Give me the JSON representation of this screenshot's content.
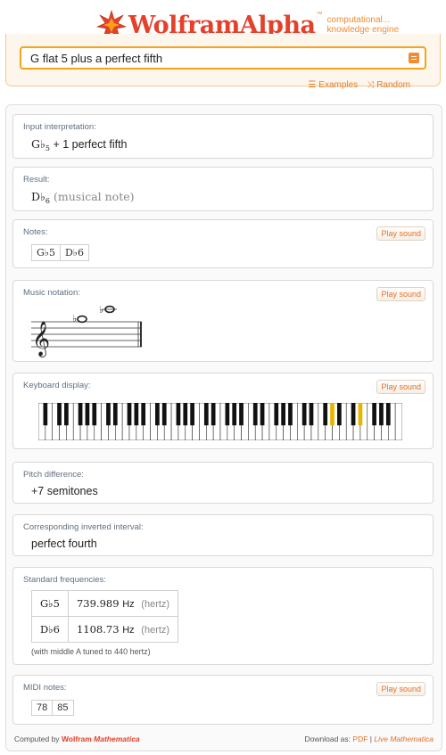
{
  "header": {
    "logo_primary": "Wolfram",
    "logo_secondary": "Alpha",
    "trademark": "™",
    "tagline_line1": "computational...",
    "tagline_line2": "knowledge engine",
    "search_value": "G flat 5 plus a perfect fifth",
    "links": [
      {
        "label": "Examples",
        "icon": "list-icon"
      },
      {
        "label": "Random",
        "icon": "shuffle-icon"
      }
    ]
  },
  "pods": {
    "input": {
      "title": "Input interpretation:",
      "note": "G♭",
      "octave": "5",
      "rest": " + 1 perfect fifth"
    },
    "result": {
      "title": "Result:",
      "note": "D♭",
      "octave": "6",
      "desc": "(musical note)"
    },
    "notes": {
      "title": "Notes:",
      "play": "Play sound",
      "items": [
        "G♭5",
        "D♭6"
      ]
    },
    "notation": {
      "title": "Music notation:",
      "play": "Play sound"
    },
    "keyboard": {
      "title": "Keyboard display:",
      "play": "Play sound",
      "highlight_color": "#e8b400"
    },
    "pitch": {
      "title": "Pitch difference:",
      "value": "+7 semitones"
    },
    "inverted": {
      "title": "Corresponding inverted interval:",
      "value": "perfect fourth"
    },
    "frequencies": {
      "title": "Standard frequencies:",
      "rows": [
        {
          "note": "G♭5",
          "value": "739.989",
          "unit": "Hz",
          "unit_name": "(hertz)"
        },
        {
          "note": "D♭6",
          "value": "1108.73",
          "unit": "Hz",
          "unit_name": "(hertz)"
        }
      ],
      "footnote": "(with middle A tuned to 440 hertz)"
    },
    "midi": {
      "title": "MIDI notes:",
      "play": "Play sound",
      "items": [
        "78",
        "85"
      ]
    }
  },
  "footer": {
    "computed_by": "Computed by",
    "brand": "Wolfram",
    "product": "Mathematica",
    "download_as": "Download as:",
    "pdf": "PDF",
    "separator": "|",
    "live": "Live Mathematica"
  },
  "colors": {
    "brand": "#e4402a",
    "accent": "#f28b30",
    "search_border": "#f6a21a"
  }
}
